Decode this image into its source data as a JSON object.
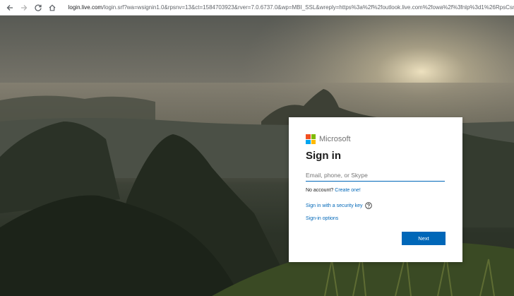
{
  "browser": {
    "back_icon": "arrow-left-icon",
    "forward_icon": "arrow-right-icon",
    "reload_icon": "reload-icon",
    "home_icon": "home-icon",
    "url_host": "login.live.com",
    "url_rest": "/login.srf?wa=wsignin1.0&rpsnv=13&ct=1584703923&rver=7.0.6737.0&wp=MBI_SSL&wreply=https%3a%2f%2foutlook.live.com%2fowa%2f%3fnlp%3d1%26RpsCsrfSta"
  },
  "signin": {
    "brand": "Microsoft",
    "title": "Sign in",
    "email_placeholder": "Email, phone, or Skype",
    "email_value": "",
    "no_account_text": "No account?",
    "create_link": "Create one!",
    "security_key_link": "Sign in with a security key",
    "options_link": "Sign-in options",
    "next_button": "Next"
  },
  "colors": {
    "accent": "#0067b8",
    "logo_red": "#f25022",
    "logo_green": "#7fba00",
    "logo_blue": "#00a4ef",
    "logo_yellow": "#ffb900"
  }
}
